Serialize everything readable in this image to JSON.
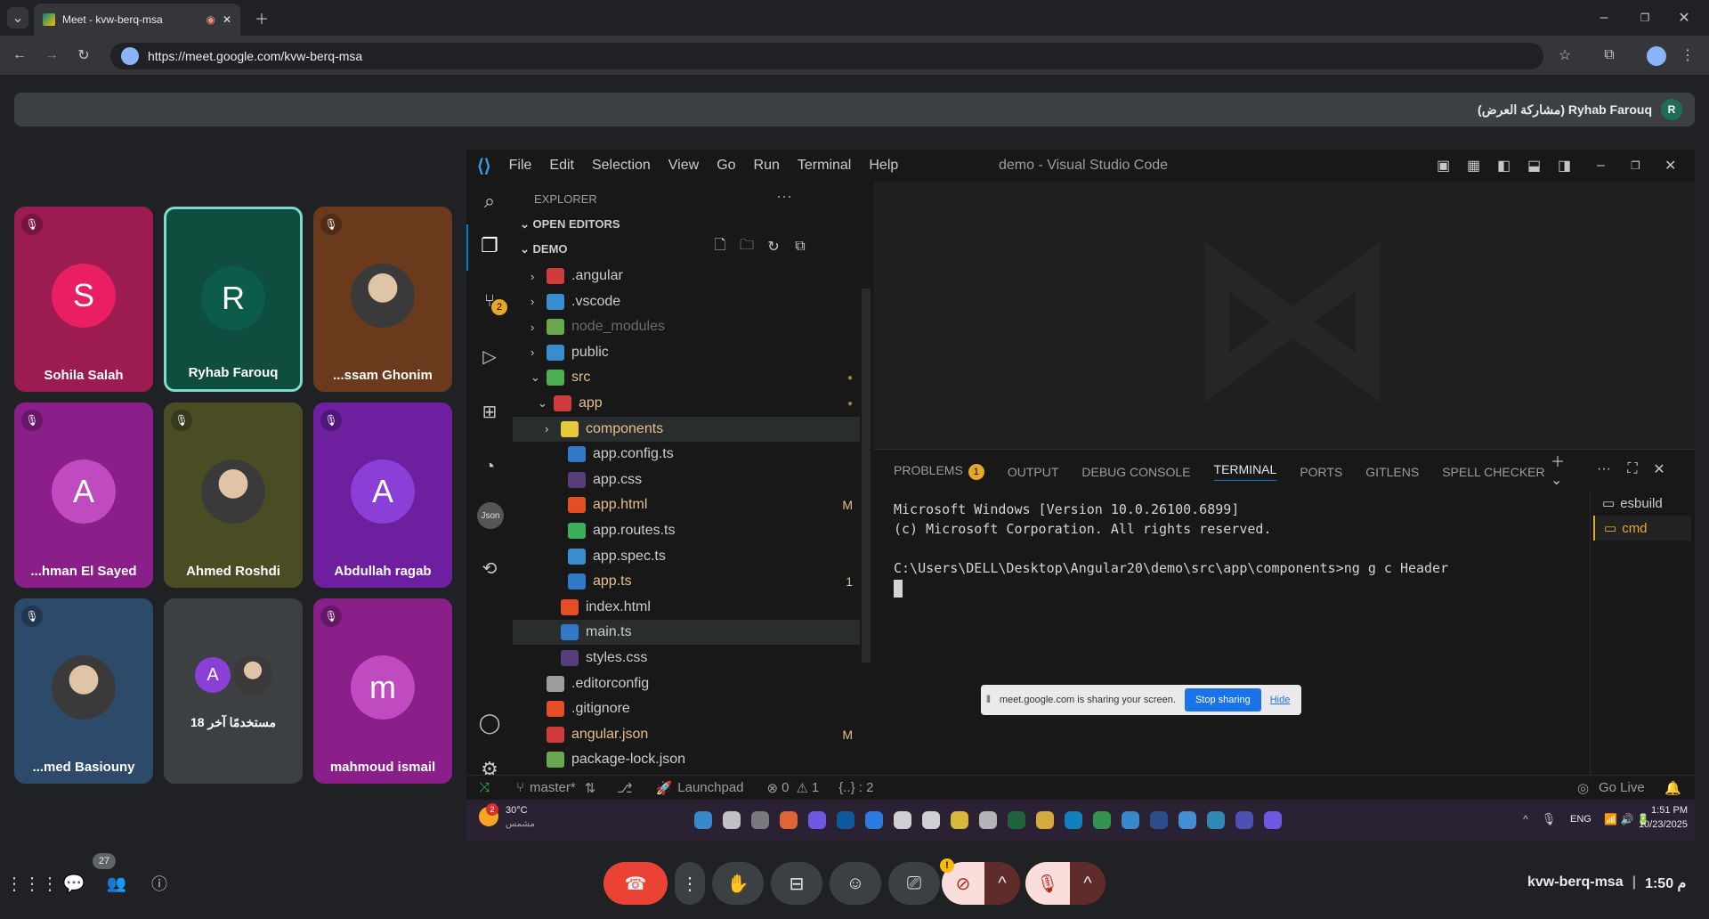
{
  "browser": {
    "tab_title": "Meet - kvw-berq-msa",
    "url": "https://meet.google.com/kvw-berq-msa"
  },
  "meet": {
    "presenter_label": "(مشاركة العرض) Ryhab Farouq",
    "presenter_initial": "R",
    "participants": [
      {
        "name": "Sohila Salah",
        "initial": "S",
        "color": "#e91e63",
        "bg": "#9c1b50"
      },
      {
        "name": "Ryhab Farouq",
        "initial": "R",
        "color": "#0d5c4a",
        "bg": "#0f4d3f"
      },
      {
        "name": "...ssam Ghonim",
        "initial": "",
        "color": "",
        "bg": "#6b3a1c"
      },
      {
        "name": "...hman El Sayed",
        "initial": "A",
        "color": "#c04ac0",
        "bg": "#8a1f8a"
      },
      {
        "name": "Ahmed Roshdi",
        "initial": "",
        "color": "",
        "bg": "#4a4d24"
      },
      {
        "name": "Abdullah ragab",
        "initial": "A",
        "color": "#8b3fd6",
        "bg": "#6d1fa0"
      },
      {
        "name": "...med Basiouny",
        "initial": "",
        "color": "",
        "bg": "#2d4a6b"
      },
      {
        "name": "18 مستخدمًا آخر",
        "initial": "A",
        "color": "#8b3fd6",
        "bg": "#3c4043"
      },
      {
        "name": "mahmoud ismail",
        "initial": "m",
        "color": "#c04ac0",
        "bg": "#8a1f8a"
      }
    ],
    "people_count": "27",
    "meeting_code": "kvw-berq-msa",
    "time": "1:50 م"
  },
  "vscode": {
    "menu": [
      "File",
      "Edit",
      "Selection",
      "View",
      "Go",
      "Run",
      "Terminal",
      "Help"
    ],
    "window_title": "demo - Visual Studio Code",
    "explorer_label": "EXPLORER",
    "open_editors": "OPEN EDITORS",
    "root": "DEMO",
    "scm_badge": "2",
    "tree": [
      {
        "label": ".angular",
        "indent": 0,
        "chev": ">",
        "color": "#d03b3b",
        "text": "#cccccc"
      },
      {
        "label": ".vscode",
        "indent": 0,
        "chev": ">",
        "color": "#3b8bd0",
        "text": "#cccccc"
      },
      {
        "label": "node_modules",
        "indent": 0,
        "chev": ">",
        "color": "#6aa84f",
        "text": "#6b6b6b"
      },
      {
        "label": "public",
        "indent": 0,
        "chev": ">",
        "color": "#3b8bd0",
        "text": "#cccccc"
      },
      {
        "label": "src",
        "indent": 0,
        "chev": "v",
        "color": "#4caf50",
        "text": "#e2c08d",
        "dot": true
      },
      {
        "label": "app",
        "indent": 1,
        "chev": "v",
        "color": "#d03b3b",
        "text": "#e2c08d",
        "dot": true
      },
      {
        "label": "components",
        "indent": 2,
        "chev": ">",
        "color": "#e6c93a",
        "text": "#e2c08d",
        "selected": true
      },
      {
        "label": "app.config.ts",
        "indent": 3,
        "chev": "",
        "color": "#3178c6",
        "text": "#cccccc"
      },
      {
        "label": "app.css",
        "indent": 3,
        "chev": "",
        "color": "#563d7c",
        "text": "#cccccc"
      },
      {
        "label": "app.html",
        "indent": 3,
        "chev": "",
        "color": "#e44d26",
        "text": "#e2c08d",
        "badge": "M"
      },
      {
        "label": "app.routes.ts",
        "indent": 3,
        "chev": "",
        "color": "#3bb05a",
        "text": "#cccccc"
      },
      {
        "label": "app.spec.ts",
        "indent": 3,
        "chev": "",
        "color": "#3b8bd0",
        "text": "#cccccc"
      },
      {
        "label": "app.ts",
        "indent": 3,
        "chev": "",
        "color": "#3178c6",
        "text": "#e2c08d",
        "badge": "1"
      },
      {
        "label": "index.html",
        "indent": 2,
        "chev": "",
        "color": "#e44d26",
        "text": "#cccccc"
      },
      {
        "label": "main.ts",
        "indent": 2,
        "chev": "",
        "color": "#3178c6",
        "text": "#cccccc",
        "hover": true
      },
      {
        "label": "styles.css",
        "indent": 2,
        "chev": "",
        "color": "#563d7c",
        "text": "#cccccc"
      },
      {
        "label": ".editorconfig",
        "indent": 0,
        "chev": "",
        "color": "#9d9d9d",
        "text": "#cccccc"
      },
      {
        "label": ".gitignore",
        "indent": 0,
        "chev": "",
        "color": "#e44d26",
        "text": "#cccccc"
      },
      {
        "label": "angular.json",
        "indent": 0,
        "chev": "",
        "color": "#d03b3b",
        "text": "#e2c08d",
        "badge": "M"
      },
      {
        "label": "package-lock.json",
        "indent": 0,
        "chev": "",
        "color": "#6aa84f",
        "text": "#cccccc"
      }
    ],
    "panel_tabs": [
      "PROBLEMS",
      "OUTPUT",
      "DEBUG CONSOLE",
      "TERMINAL",
      "PORTS",
      "GITLENS",
      "SPELL CHECKER"
    ],
    "problems_count": "1",
    "terminal_lines": [
      "Microsoft Windows [Version 10.0.26100.6899]",
      "(c) Microsoft Corporation. All rights reserved.",
      "",
      "C:\\Users\\DELL\\Desktop\\Angular20\\demo\\src\\app\\components>ng g c Header"
    ],
    "terminals": [
      "esbuild",
      "cmd"
    ],
    "sharing_text": "meet.google.com is sharing your screen.",
    "stop_sharing": "Stop sharing",
    "hide": "Hide",
    "status": {
      "branch": "master*",
      "launchpad": "Launchpad",
      "errors": "0",
      "warnings": "1",
      "cursor": "{..} : 2",
      "golive": "Go Live"
    },
    "taskbar": {
      "weather": "30°C",
      "weather_sub": "مشمس",
      "weather_badge": "2",
      "lang": "ENG",
      "time": "1:51 PM",
      "date": "10/23/2025"
    }
  }
}
